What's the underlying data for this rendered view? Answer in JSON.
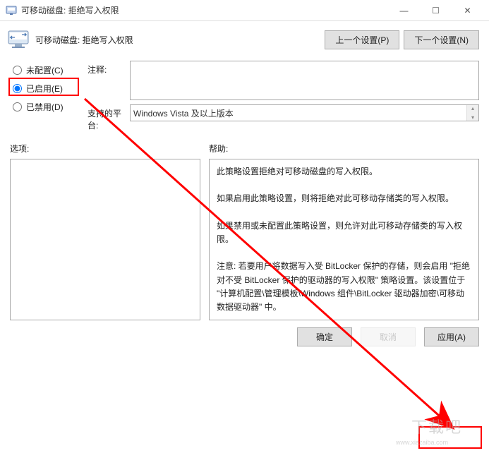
{
  "window": {
    "title": "可移动磁盘: 拒绝写入权限",
    "minimize": "—",
    "maximize": "☐",
    "close": "✕"
  },
  "header": {
    "policy_title": "可移动磁盘: 拒绝写入权限",
    "prev_setting": "上一个设置(P)",
    "next_setting": "下一个设置(N)"
  },
  "radios": {
    "not_configured": "未配置(C)",
    "enabled": "已启用(E)",
    "disabled": "已禁用(D)",
    "selected": "enabled"
  },
  "fields": {
    "comment_label": "注释:",
    "comment_value": "",
    "platform_label": "支持的平台:",
    "platform_value": "Windows Vista 及以上版本"
  },
  "columns": {
    "options_label": "选项:",
    "help_label": "帮助:"
  },
  "help_text": "此策略设置拒绝对可移动磁盘的写入权限。\n\n如果启用此策略设置，则将拒绝对此可移动存储类的写入权限。\n\n如果禁用或未配置此策略设置，则允许对此可移动存储类的写入权限。\n\n注意: 若要用户将数据写入受 BitLocker 保护的存储，则会启用 \"拒绝对不受 BitLocker 保护的驱动器的写入权限\" 策略设置。该设置位于 \"计算机配置\\管理模板\\Windows 组件\\BitLocker 驱动器加密\\可移动数据驱动器\" 中。",
  "footer": {
    "ok": "确定",
    "cancel": "取消",
    "apply": "应用(A)"
  },
  "watermark": {
    "main": "下载吧",
    "sub": "www.xiazaiba.com"
  }
}
